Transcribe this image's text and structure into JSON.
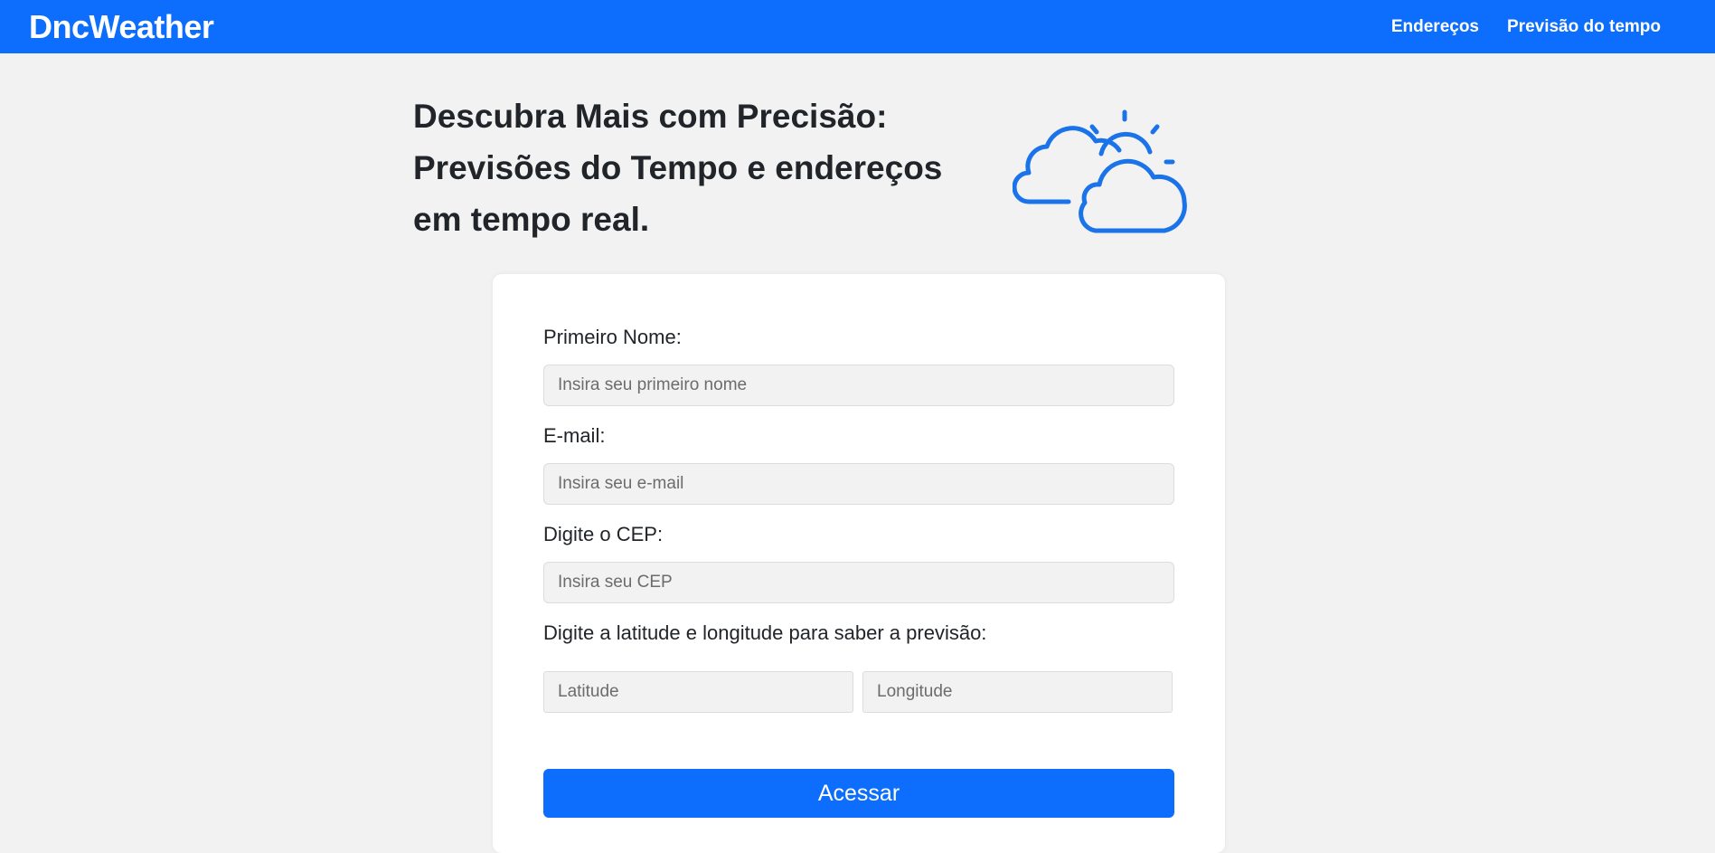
{
  "navbar": {
    "brand": "DncWeather",
    "links": [
      {
        "label": "Endereços"
      },
      {
        "label": "Previsão do tempo"
      }
    ]
  },
  "hero": {
    "title_lines": [
      "Descubra Mais com Precisão:",
      "Previsões do Tempo e endereços",
      "em tempo real."
    ],
    "icon": "cloud-sun-icon",
    "icon_color": "#1a73e8"
  },
  "form": {
    "first_name": {
      "label": "Primeiro Nome:",
      "placeholder": "Insira seu primeiro nome",
      "value": ""
    },
    "email": {
      "label": "E-mail:",
      "placeholder": "Insira seu e-mail",
      "value": ""
    },
    "cep": {
      "label": "Digite o CEP:",
      "placeholder": "Insira seu CEP",
      "value": ""
    },
    "coords": {
      "label": "Digite a latitude e longitude para saber a previsão:",
      "latitude_placeholder": "Latitude",
      "longitude_placeholder": "Longitude"
    },
    "submit_label": "Acessar"
  },
  "colors": {
    "primary": "#0d6efd",
    "background": "#f2f2f2",
    "card": "#ffffff",
    "text": "#212529"
  }
}
